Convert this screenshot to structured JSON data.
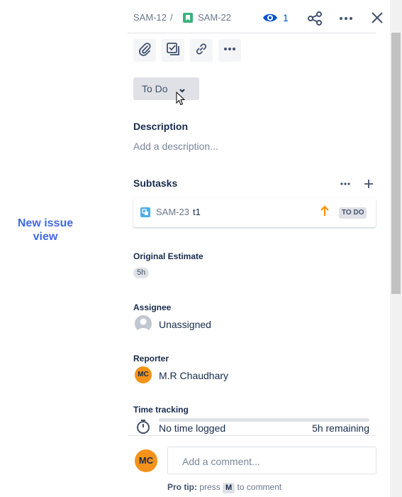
{
  "annotation": {
    "text": "New issue view"
  },
  "breadcrumb": {
    "parent_key": "SAM-12",
    "separator": "/",
    "issue_key": "SAM-22"
  },
  "header": {
    "watch_count": "1"
  },
  "status": {
    "label": "To Do"
  },
  "description": {
    "title": "Description",
    "placeholder": "Add a description..."
  },
  "subtasks": {
    "title": "Subtasks",
    "items": [
      {
        "key": "SAM-23",
        "summary": "t1",
        "status": "TO DO"
      }
    ]
  },
  "original_estimate": {
    "label": "Original Estimate",
    "value": "5h"
  },
  "assignee": {
    "label": "Assignee",
    "value": "Unassigned"
  },
  "reporter": {
    "label": "Reporter",
    "initials": "MC",
    "name": "M.R Chaudhary"
  },
  "time_tracking": {
    "label": "Time tracking",
    "logged": "No time logged",
    "remaining": "5h remaining",
    "progress": 0
  },
  "comment": {
    "avatar_initials": "MC",
    "placeholder": "Add a comment...",
    "pro_tip_label": "Pro tip:",
    "pro_tip_press": "press",
    "pro_tip_key": "M",
    "pro_tip_suffix": "to comment"
  },
  "colors": {
    "accent": "#0052cc",
    "story_icon": "#36b37e",
    "subtask_icon": "#4bade8",
    "priority": "#ff8b00",
    "avatar": "#f4921b",
    "annotation": "#4169e1"
  }
}
